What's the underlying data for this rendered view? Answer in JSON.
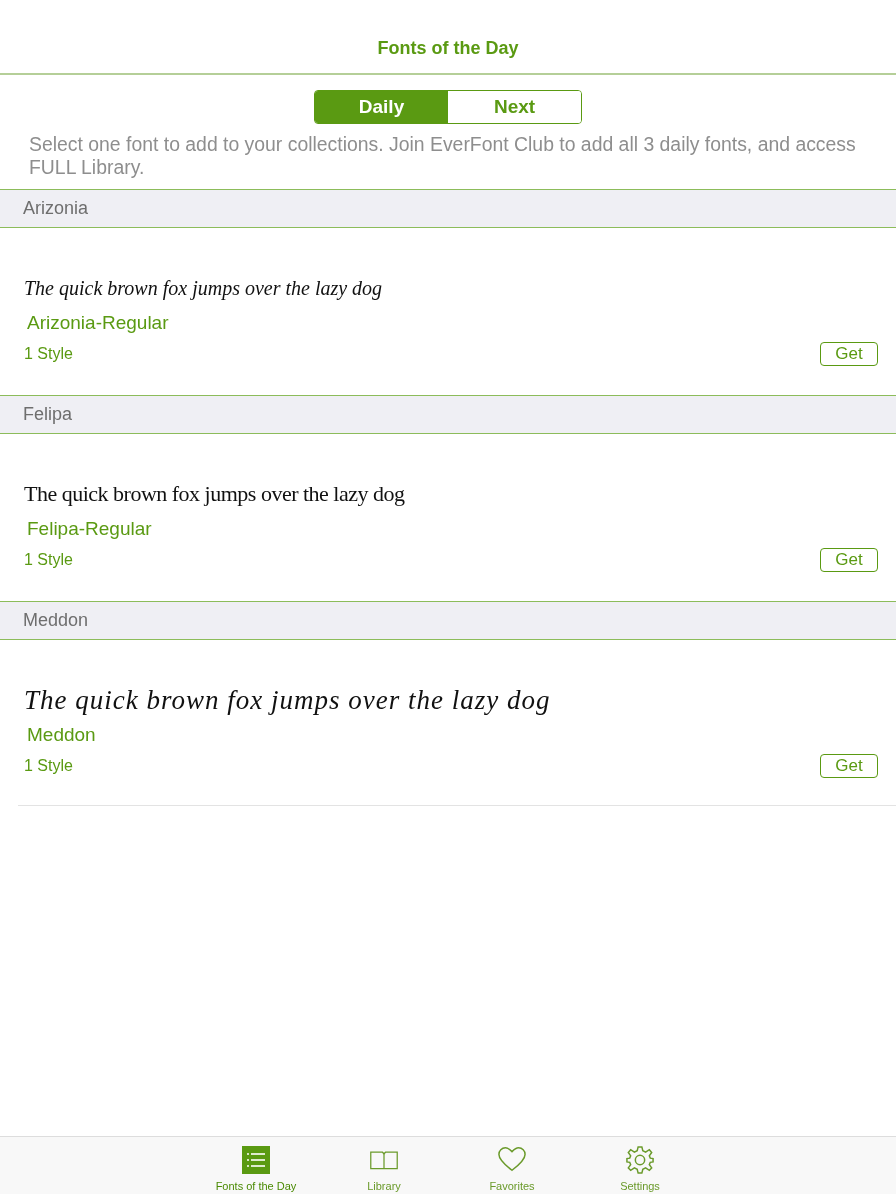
{
  "nav_bar": {
    "title": "Fonts of the Day"
  },
  "segments": [
    {
      "label": "Daily",
      "selected": true
    },
    {
      "label": "Next",
      "selected": false
    }
  ],
  "description": "Select one font to add to your collections. Join EverFont Club to add all 3 daily fonts, and access FULL Library.",
  "sections": [
    {
      "header": "Arizonia",
      "font": {
        "sample": "The quick brown fox jumps over the lazy dog",
        "name": "Arizonia-Regular",
        "styles": "1 Style",
        "button": "Get"
      }
    },
    {
      "header": "Felipa",
      "font": {
        "sample": "The quick brown fox jumps over the lazy dog",
        "name": "Felipa-Regular",
        "styles": "1 Style",
        "button": "Get"
      }
    },
    {
      "header": "Meddon",
      "font": {
        "sample": "The quick brown fox jumps over the lazy dog",
        "name": "Meddon",
        "styles": "1 Style",
        "button": "Get"
      }
    }
  ],
  "tab_bar": [
    {
      "label": "Fonts of the Day",
      "kind": "list",
      "selected": true
    },
    {
      "label": "Library",
      "kind": "book",
      "selected": false
    },
    {
      "label": "Favorites",
      "kind": "heart",
      "selected": false
    },
    {
      "label": "Settings",
      "kind": "gear",
      "selected": false
    }
  ]
}
